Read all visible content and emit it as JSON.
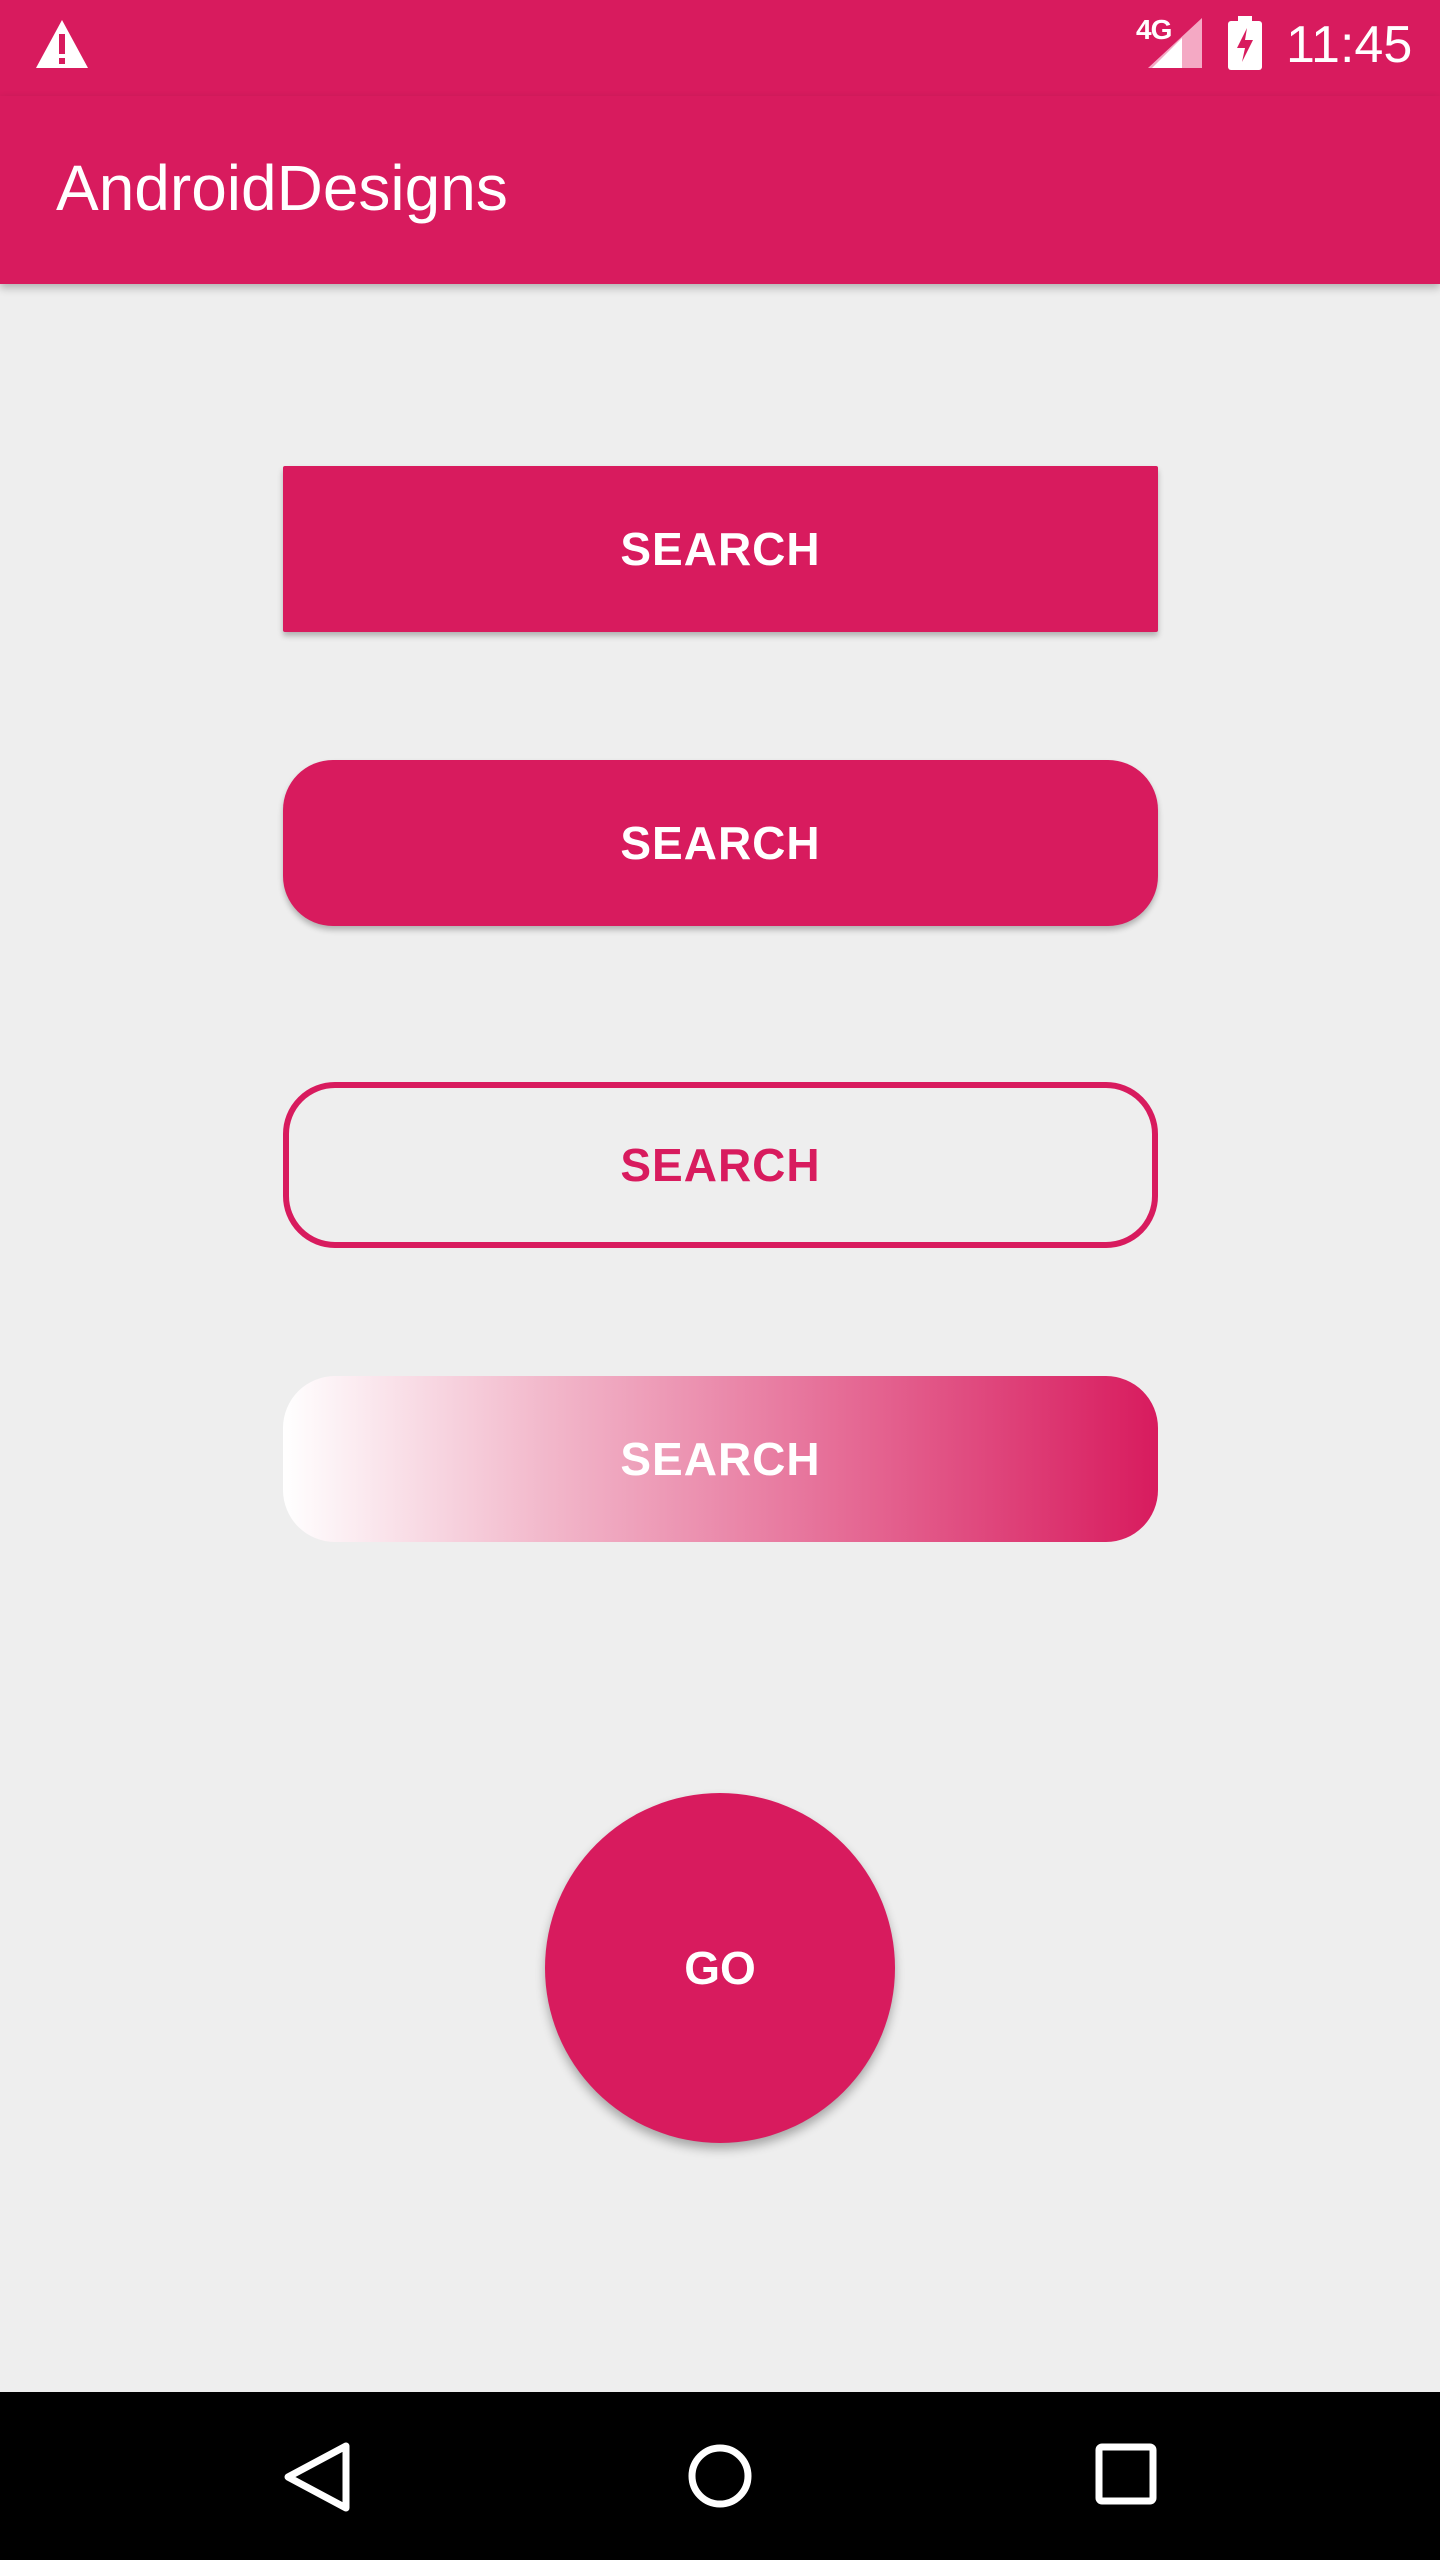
{
  "status_bar": {
    "network_type": "4G",
    "time": "11:45",
    "icons": [
      "warning-icon",
      "signal-icon",
      "battery-charging-icon"
    ]
  },
  "app_bar": {
    "title": "AndroidDesigns"
  },
  "buttons": {
    "rect_label": "SEARCH",
    "rounded_label": "SEARCH",
    "outline_label": "SEARCH",
    "gradient_label": "SEARCH",
    "fab_label": "GO"
  },
  "nav_bar": {
    "icons": [
      "back-icon",
      "home-icon",
      "recents-icon"
    ]
  },
  "colors": {
    "accent": "#d81b5e",
    "background": "#eeeeee",
    "nav_background": "#000000",
    "text_on_accent": "#ffffff"
  }
}
